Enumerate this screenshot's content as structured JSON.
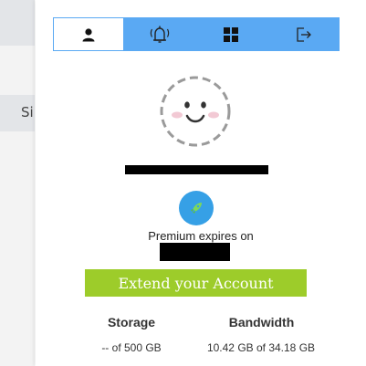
{
  "sidebar": {
    "partial_label": "Si"
  },
  "tabs": [
    {
      "name": "profile",
      "icon": "user-icon",
      "active": true
    },
    {
      "name": "notifications",
      "icon": "bell-icon",
      "active": false
    },
    {
      "name": "dashboard",
      "icon": "grid-icon",
      "active": false
    },
    {
      "name": "logout",
      "icon": "logout-icon",
      "active": false
    }
  ],
  "profile": {
    "avatar_icon": "smiley-face-icon"
  },
  "premium": {
    "label": "Premium expires on",
    "badge_icon": "rocket-icon"
  },
  "extend_button": {
    "label": "Extend your Account"
  },
  "stats": {
    "storage": {
      "title": "Storage",
      "value": "-- of 500 GB"
    },
    "bandwidth": {
      "title": "Bandwidth",
      "value": "10.42 GB of 34.18 GB"
    }
  },
  "colors": {
    "tab_bar": "#5aa9f3",
    "extend_button": "#9dcc2a",
    "badge": "#36a0e6"
  }
}
